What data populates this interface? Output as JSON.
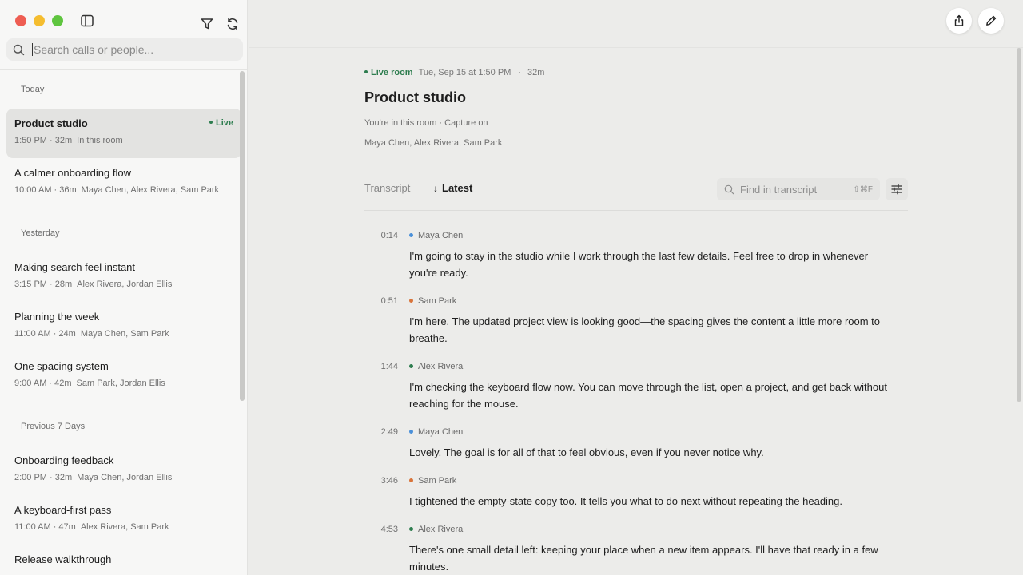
{
  "sidebar": {
    "search_placeholder": "Search calls or people...",
    "groups": [
      {
        "label": "Today",
        "items": [
          {
            "title": "Product studio",
            "time": "1:50 PM · 32m",
            "people": "In this room",
            "live": "Live"
          },
          {
            "title": "A calmer onboarding flow",
            "time": "10:00 AM · 36m",
            "people": "Maya Chen, Alex Rivera, Sam Park"
          }
        ]
      },
      {
        "label": "Yesterday",
        "items": [
          {
            "title": "Making search feel instant",
            "time": "3:15 PM · 28m",
            "people": "Alex Rivera, Jordan Ellis"
          },
          {
            "title": "Planning the week",
            "time": "11:00 AM · 24m",
            "people": "Maya Chen, Sam Park"
          },
          {
            "title": "One spacing system",
            "time": "9:00 AM · 42m",
            "people": "Sam Park, Jordan Ellis"
          }
        ]
      },
      {
        "label": "Previous 7 Days",
        "items": [
          {
            "title": "Onboarding feedback",
            "time": "2:00 PM · 32m",
            "people": "Maya Chen, Jordan Ellis"
          },
          {
            "title": "A keyboard-first pass",
            "time": "11:00 AM · 47m",
            "people": "Alex Rivera, Sam Park"
          },
          {
            "title": "Release walkthrough",
            "time": "",
            "people": ""
          }
        ]
      }
    ]
  },
  "room": {
    "live_label": "Live room",
    "date": "Tue, Sep 15 at 1:50 PM",
    "separator": "·",
    "duration": "32m",
    "title": "Product studio",
    "subtitle": "You're in this room · Capture on",
    "people": "Maya Chen, Alex Rivera, Sam Park"
  },
  "transcript": {
    "tab_label": "Transcript",
    "sort_label": "Latest",
    "sort_arrow": "↓",
    "find_placeholder": "Find in transcript",
    "find_shortcut": "⇧⌘F",
    "entries": [
      {
        "time": "0:14",
        "speaker": "Maya Chen",
        "color": "#4a90d9",
        "text": "I'm going to stay in the studio while I work through the last few details. Feel free to drop in whenever you're ready."
      },
      {
        "time": "0:51",
        "speaker": "Sam Park",
        "color": "#d9743a",
        "text": "I'm here. The updated project view is looking good—the spacing gives the content a little more room to breathe."
      },
      {
        "time": "1:44",
        "speaker": "Alex Rivera",
        "color": "#2e7d4f",
        "text": "I'm checking the keyboard flow now. You can move through the list, open a project, and get back without reaching for the mouse."
      },
      {
        "time": "2:49",
        "speaker": "Maya Chen",
        "color": "#4a90d9",
        "text": "Lovely. The goal is for all of that to feel obvious, even if you never notice why."
      },
      {
        "time": "3:46",
        "speaker": "Sam Park",
        "color": "#d9743a",
        "text": "I tightened the empty-state copy too. It tells you what to do next without repeating the heading."
      },
      {
        "time": "4:53",
        "speaker": "Alex Rivera",
        "color": "#2e7d4f",
        "text": "There's one small detail left: keeping your place when a new item appears. I'll have that ready in a few minutes."
      }
    ]
  }
}
